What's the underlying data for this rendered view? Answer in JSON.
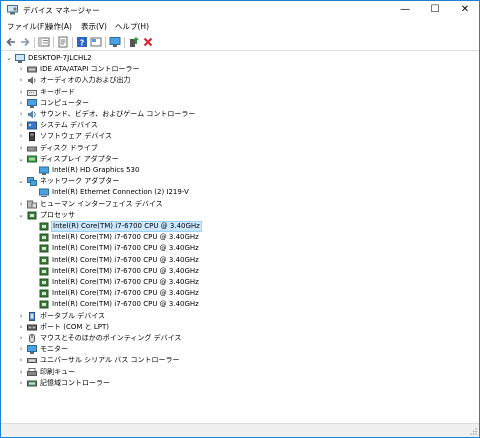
{
  "window": {
    "title": "デバイス マネージャー",
    "controls": {
      "minimize": "—",
      "maximize": "☐",
      "close": "✕"
    }
  },
  "menu": [
    "ファイル(F)",
    "操作(A)",
    "表示(V)",
    "ヘルプ(H)"
  ],
  "toolbar": [
    "back-icon",
    "forward-icon",
    "show-hide-icon",
    "properties-icon",
    "help-icon",
    "view-icon",
    "monitor-scan-icon",
    "update-driver-icon",
    "uninstall-icon"
  ],
  "tree": {
    "root": "DESKTOP-7JLCHL2",
    "nodes": [
      {
        "label": "IDE ATA/ATAPI コントローラー",
        "icon": "ide-controller-icon",
        "expanded": false
      },
      {
        "label": "オーディオの入力および出力",
        "icon": "audio-icon",
        "expanded": false
      },
      {
        "label": "キーボード",
        "icon": "keyboard-icon",
        "expanded": false
      },
      {
        "label": "コンピューター",
        "icon": "computer-icon",
        "expanded": false
      },
      {
        "label": "サウンド、ビデオ、およびゲーム コントローラー",
        "icon": "sound-icon",
        "expanded": false
      },
      {
        "label": "システム デバイス",
        "icon": "system-device-icon",
        "expanded": false
      },
      {
        "label": "ソフトウェア デバイス",
        "icon": "software-device-icon",
        "expanded": false
      },
      {
        "label": "ディスク ドライブ",
        "icon": "disk-drive-icon",
        "expanded": false
      },
      {
        "label": "ディスプレイ アダプター",
        "icon": "display-adapter-icon",
        "expanded": true,
        "children": [
          "Intel(R) HD Graphics 530"
        ]
      },
      {
        "label": "ネットワーク アダプター",
        "icon": "network-adapter-icon",
        "expanded": true,
        "children": [
          "Intel(R) Ethernet Connection (2) I219-V"
        ]
      },
      {
        "label": "ヒューマン インターフェイス デバイス",
        "icon": "hid-icon",
        "expanded": false
      },
      {
        "label": "プロセッサ",
        "icon": "processor-icon",
        "expanded": true,
        "children": [
          "Intel(R) Core(TM) i7-6700 CPU @ 3.40GHz",
          "Intel(R) Core(TM) i7-6700 CPU @ 3.40GHz",
          "Intel(R) Core(TM) i7-6700 CPU @ 3.40GHz",
          "Intel(R) Core(TM) i7-6700 CPU @ 3.40GHz",
          "Intel(R) Core(TM) i7-6700 CPU @ 3.40GHz",
          "Intel(R) Core(TM) i7-6700 CPU @ 3.40GHz",
          "Intel(R) Core(TM) i7-6700 CPU @ 3.40GHz",
          "Intel(R) Core(TM) i7-6700 CPU @ 3.40GHz"
        ]
      },
      {
        "label": "ポータブル デバイス",
        "icon": "portable-device-icon",
        "expanded": false
      },
      {
        "label": "ポート (COM と LPT)",
        "icon": "port-icon",
        "expanded": false
      },
      {
        "label": "マウスとそのほかのポインティング デバイス",
        "icon": "mouse-icon",
        "expanded": false
      },
      {
        "label": "モニター",
        "icon": "monitor-icon",
        "expanded": false
      },
      {
        "label": "ユニバーサル シリアル バス コントローラー",
        "icon": "usb-icon",
        "expanded": false
      },
      {
        "label": "印刷キュー",
        "icon": "print-queue-icon",
        "expanded": false
      },
      {
        "label": "記憶域コントローラー",
        "icon": "storage-controller-icon",
        "expanded": false
      }
    ],
    "selected": "Intel(R) Core(TM) i7-6700 CPU @ 3.40GHz"
  },
  "colors": {
    "accent": "#1883d7",
    "selection": "#cce8ff",
    "uninstall": "#d9262f",
    "update": "#2e9a3a"
  }
}
